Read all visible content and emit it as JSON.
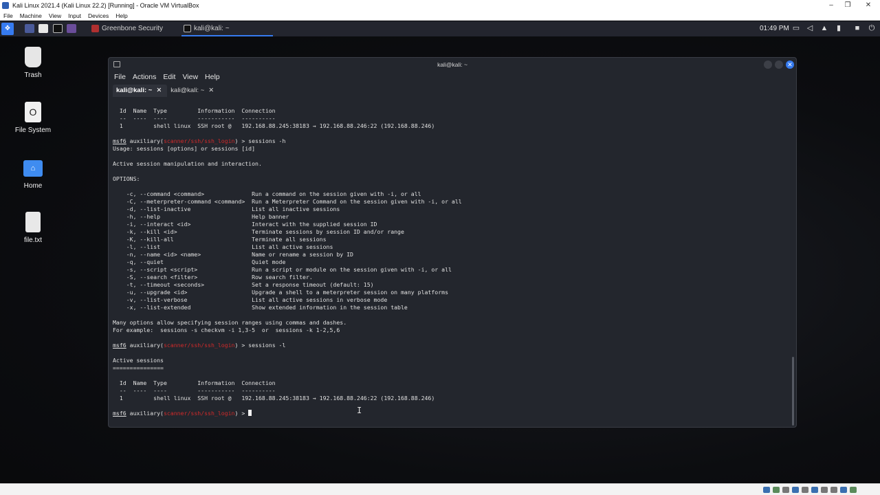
{
  "vbox": {
    "title": "Kali Linux 2021.4 (Kali Linux 22.2) [Running] - Oracle VM VirtualBox",
    "menu": [
      "File",
      "Machine",
      "View",
      "Input",
      "Devices",
      "Help"
    ]
  },
  "panel": {
    "tasks": [
      {
        "label": "Greenbone Security Ass..."
      },
      {
        "label": "kali@kali: ~"
      }
    ],
    "clock": "01:49 PM"
  },
  "desktop": {
    "icons": [
      {
        "label": "Trash"
      },
      {
        "label": "File System"
      },
      {
        "label": "Home"
      },
      {
        "label": "file.txt"
      }
    ]
  },
  "terminal": {
    "title": "kali@kali: ~",
    "menu": [
      "File",
      "Actions",
      "Edit",
      "View",
      "Help"
    ],
    "tabs": [
      {
        "label": "kali@kali: ~",
        "close": "✕"
      },
      {
        "label": "kali@kali: ~",
        "close": "✕"
      }
    ],
    "lines": {
      "h1": "  Id  Name  Type         Information  Connection",
      "u1": "  --  ----  ----         -----------  ----------",
      "r1": "  1         shell linux  SSH root @   192.168.88.245:38183 → 192.168.88.246:22 (192.168.88.246)",
      "p1_pre": "msf6",
      "p1_mid": " auxiliary(",
      "p1_mod": "scanner/ssh/ssh_login",
      "p1_cmd": ") > sessions -h",
      "usage": "Usage: sessions [options] or sessions [id]",
      "desc": "Active session manipulation and interaction.",
      "options": "OPTIONS:",
      "o1": "    -c, --command <command>              Run a command on the session given with -i, or all",
      "o2": "    -C, --meterpreter-command <command>  Run a Meterpreter Command on the session given with -i, or all",
      "o3": "    -d, --list-inactive                  List all inactive sessions",
      "o4": "    -h, --help                           Help banner",
      "o5": "    -i, --interact <id>                  Interact with the supplied session ID",
      "o6": "    -k, --kill <id>                      Terminate sessions by session ID and/or range",
      "o7": "    -K, --kill-all                       Terminate all sessions",
      "o8": "    -l, --list                           List all active sessions",
      "o9": "    -n, --name <id> <name>               Name or rename a session by ID",
      "o10": "    -q, --quiet                          Quiet mode",
      "o11": "    -s, --script <script>                Run a script or module on the session given with -i, or all",
      "o12": "    -S, --search <filter>                Row search filter.",
      "o13": "    -t, --timeout <seconds>              Set a response timeout (default: 15)",
      "o14": "    -u, --upgrade <id>                   Upgrade a shell to a meterpreter session on many platforms",
      "o15": "    -v, --list-verbose                   List all active sessions in verbose mode",
      "o16": "    -x, --list-extended                  Show extended information in the session table",
      "many": "Many options allow specifying session ranges using commas and dashes.",
      "example": "For example:  sessions -s checkvm -i 1,3-5  or  sessions -k 1-2,5,6",
      "p2_cmd": ") > sessions -l",
      "active": "Active sessions",
      "active_ul": "===============",
      "p3_cmd": ") > "
    }
  }
}
